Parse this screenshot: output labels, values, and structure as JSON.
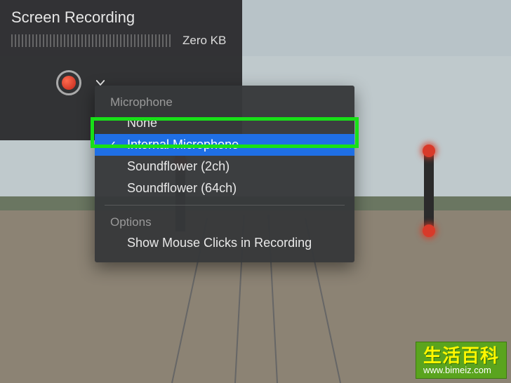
{
  "panel": {
    "title": "Screen Recording",
    "size_label": "Zero KB"
  },
  "menu": {
    "section_mic": "Microphone",
    "items_mic": [
      {
        "label": "None",
        "selected": false
      },
      {
        "label": "Internal Microphone",
        "selected": true
      },
      {
        "label": "Soundflower (2ch)",
        "selected": false
      },
      {
        "label": "Soundflower (64ch)",
        "selected": false
      }
    ],
    "section_options": "Options",
    "items_options": [
      {
        "label": "Show Mouse Clicks in Recording"
      }
    ]
  },
  "watermark": {
    "brand": "生活百科",
    "url": "www.bimeiz.com"
  }
}
